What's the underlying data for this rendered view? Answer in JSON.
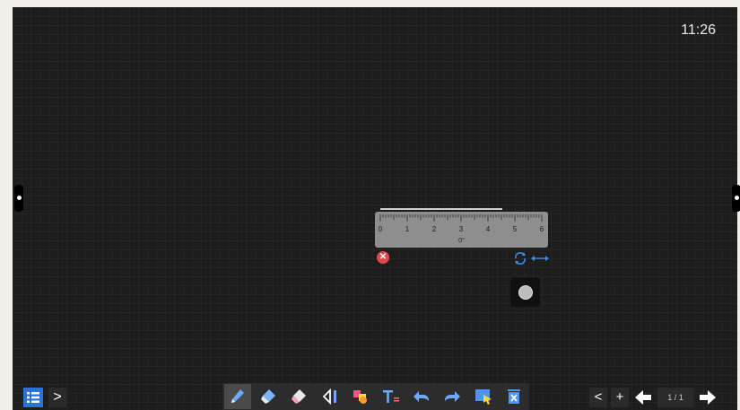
{
  "clock": "11:26",
  "ruler": {
    "labels": [
      "0",
      "1",
      "2",
      "3",
      "4",
      "5",
      "6"
    ],
    "angle": "0°"
  },
  "toolbar": {
    "tools": [
      {
        "name": "pen-tool",
        "icon": "pen-icon",
        "active": true
      },
      {
        "name": "eraser-tool",
        "icon": "eraser-icon"
      },
      {
        "name": "area-eraser-tool",
        "icon": "area-eraser-icon"
      },
      {
        "name": "geometry-tool",
        "icon": "triangle-ruler-icon"
      },
      {
        "name": "shapes-tool",
        "icon": "shapes-icon"
      },
      {
        "name": "text-tool",
        "icon": "text-icon"
      },
      {
        "name": "undo-button",
        "icon": "undo-icon"
      },
      {
        "name": "redo-button",
        "icon": "redo-icon"
      },
      {
        "name": "select-tool",
        "icon": "select-icon"
      },
      {
        "name": "clear-button",
        "icon": "trash-icon"
      }
    ]
  },
  "page_nav": {
    "prev_label": "<",
    "add_label": "+",
    "page_indicator": "1 / 1"
  },
  "left_menu": {
    "expand_label": ">"
  },
  "colors": {
    "board_bg": "#1d1d1d",
    "accent_blue": "#3a8ee6",
    "close_red": "#e04848",
    "ruler_gray": "#8e8e8e"
  }
}
